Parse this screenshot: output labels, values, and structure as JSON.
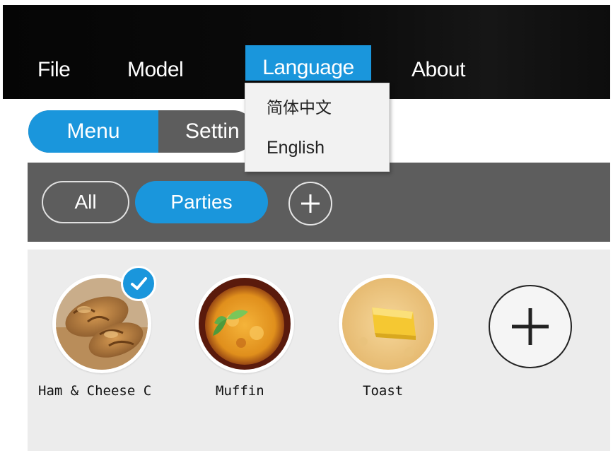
{
  "menubar": {
    "items": [
      {
        "label": "File"
      },
      {
        "label": "Model"
      },
      {
        "label": "Language"
      },
      {
        "label": "About"
      }
    ]
  },
  "language_dropdown": {
    "options": [
      {
        "label": "简体中文"
      },
      {
        "label": "English"
      }
    ]
  },
  "tabs": {
    "menu_label": "Menu",
    "settings_label": "Settin"
  },
  "categories": {
    "all_label": "All",
    "parties_label": "Parties",
    "add_icon": "plus-icon"
  },
  "items": [
    {
      "label": "Ham & Cheese C",
      "image": "croissant",
      "selected": true
    },
    {
      "label": "Muffin",
      "image": "muffin",
      "selected": false
    },
    {
      "label": "Toast",
      "image": "toast",
      "selected": false
    }
  ],
  "colors": {
    "accent": "#1a96dc",
    "menubar_bg": "#0a0a0a",
    "bar_gray": "#5d5d5d",
    "panel_bg": "#ececec"
  }
}
